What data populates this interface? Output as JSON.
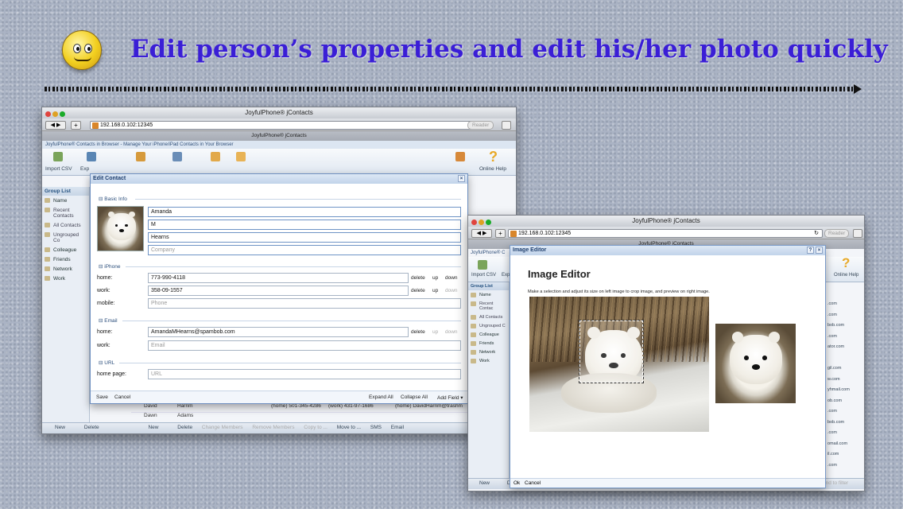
{
  "headline": "Edit person’s properties and edit his/her photo quickly",
  "left_window": {
    "title": "JoyfulPhone® jContacts",
    "url": "192.168.0.102:12345",
    "reader": "Reader",
    "tab": "JoyfulPhone® jContacts",
    "app_banner": "JoyfulPhone® Contacts in Browser - Manage Your iPhone/iPad Contacts in Your Browser",
    "toolbar": {
      "import_csv": "Import CSV",
      "export": "Exp",
      "online_help": "Online Help"
    },
    "group_list": {
      "header": "Group List",
      "column": "Name",
      "items": [
        "Recent Contacts",
        "All Contacts",
        "Ungrouped Co",
        "Colleague",
        "Friends",
        "Network",
        "Work"
      ]
    },
    "bottom": {
      "new": "New",
      "delete": "Delete",
      "new2": "New",
      "delete2": "Delete",
      "change_members": "Change Members",
      "remove_members": "Remove Members",
      "copy_to": "Copy to ...",
      "move_to": "Move to ...",
      "sms": "SMS",
      "email": "Email"
    },
    "list_rows": [
      {
        "first": "David",
        "last": "Harrim",
        "phone": "(home) 501-345-4286",
        "work": "(work) 431-97-1686",
        "email": "(home) DavidHarrim@trashm"
      },
      {
        "first": "Dawn",
        "last": "Adams",
        "phone": "",
        "work": "",
        "email": ""
      }
    ]
  },
  "edit_contact": {
    "title": "Edit Contact",
    "close": "×",
    "basic_info_label": "Basic Info",
    "first_name": "Amanda",
    "middle_name": "M",
    "last_name": "Hearns",
    "company_placeholder": "Company",
    "phone_label": "iPhone",
    "phones": [
      {
        "label": "home:",
        "value": "773-990-4118",
        "placeholder": ""
      },
      {
        "label": "work:",
        "value": "358-09-1557",
        "placeholder": ""
      },
      {
        "label": "mobile:",
        "value": "",
        "placeholder": "Phone"
      }
    ],
    "email_label": "Email",
    "emails": [
      {
        "label": "home:",
        "value": "AmandaMHearns@spambob.com",
        "placeholder": ""
      },
      {
        "label": "work:",
        "value": "",
        "placeholder": "Email"
      }
    ],
    "url_label": "URL",
    "url_field": {
      "label": "home page:",
      "placeholder": "URL"
    },
    "actions": {
      "delete": "delete",
      "up": "up",
      "down": "down"
    },
    "footer": {
      "save": "Save",
      "cancel": "Cancel",
      "expand_all": "Expand All",
      "collapse_all": "Collapse All",
      "add_field": "Add Field ▾"
    }
  },
  "right_window": {
    "title": "JoyfulPhone® jContacts",
    "url": "192.168.0.102:12345",
    "reader": "Reader",
    "tab": "JoyfulPhone® jContacts",
    "app_banner": "JoyfulPhone® C",
    "toolbar": {
      "import_csv": "Import CSV",
      "export": "Exp",
      "online_help": "Online Help"
    },
    "group_list": {
      "header": "Group List",
      "column": "Name",
      "items": [
        "Recent Contac",
        "All Contacts",
        "Ungrouped C",
        "Colleague",
        "Friends",
        "Network",
        "Work"
      ]
    },
    "email_cells": [
      ".com",
      ".com",
      "bob.com",
      ".com",
      "ator.com",
      "",
      "gil.com",
      "w.com",
      "yhmail.com",
      "ob.com",
      ".com",
      "bob.com",
      ".com",
      "omail.com",
      "il.com",
      ".com"
    ],
    "bottom": {
      "new": "New",
      "delete": "Dele",
      "send_to_filter": "end to filter"
    }
  },
  "image_editor": {
    "window_title": "Image Editor",
    "heading": "Image Editor",
    "instructions": "Make a selection and adjust its size on left image to crop image, and preview on right image.",
    "ok": "Ok",
    "cancel": "Cancel",
    "help": "?",
    "close": "×"
  }
}
